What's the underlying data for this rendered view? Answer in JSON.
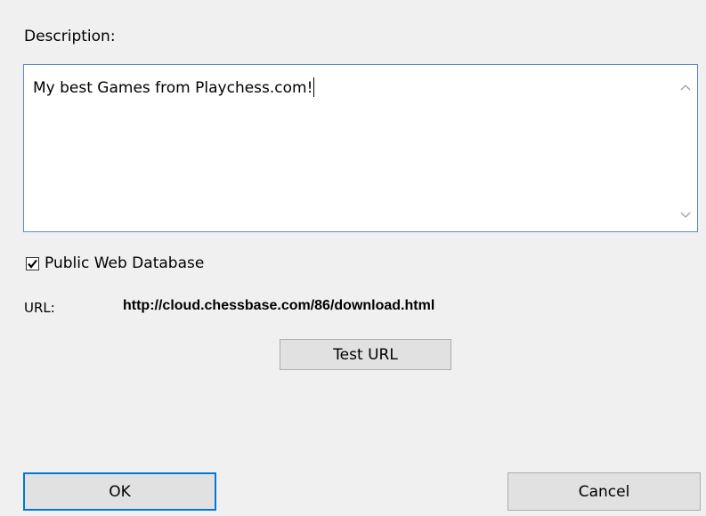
{
  "description": {
    "label": "Description:",
    "value": "My best Games from Playchess.com!"
  },
  "public_web_database": {
    "label": "Public Web Database",
    "checked": true
  },
  "url": {
    "label": "URL:",
    "value": "http://cloud.chessbase.com/86/download.html"
  },
  "buttons": {
    "test_url": "Test URL",
    "ok": "OK",
    "cancel": "Cancel"
  },
  "icons": {
    "scroll_up": "chevron-up-icon",
    "scroll_down": "chevron-down-icon",
    "checkmark": "checkmark-icon"
  },
  "colors": {
    "focus_border": "#0078d7",
    "background": "#f0f0f0"
  }
}
